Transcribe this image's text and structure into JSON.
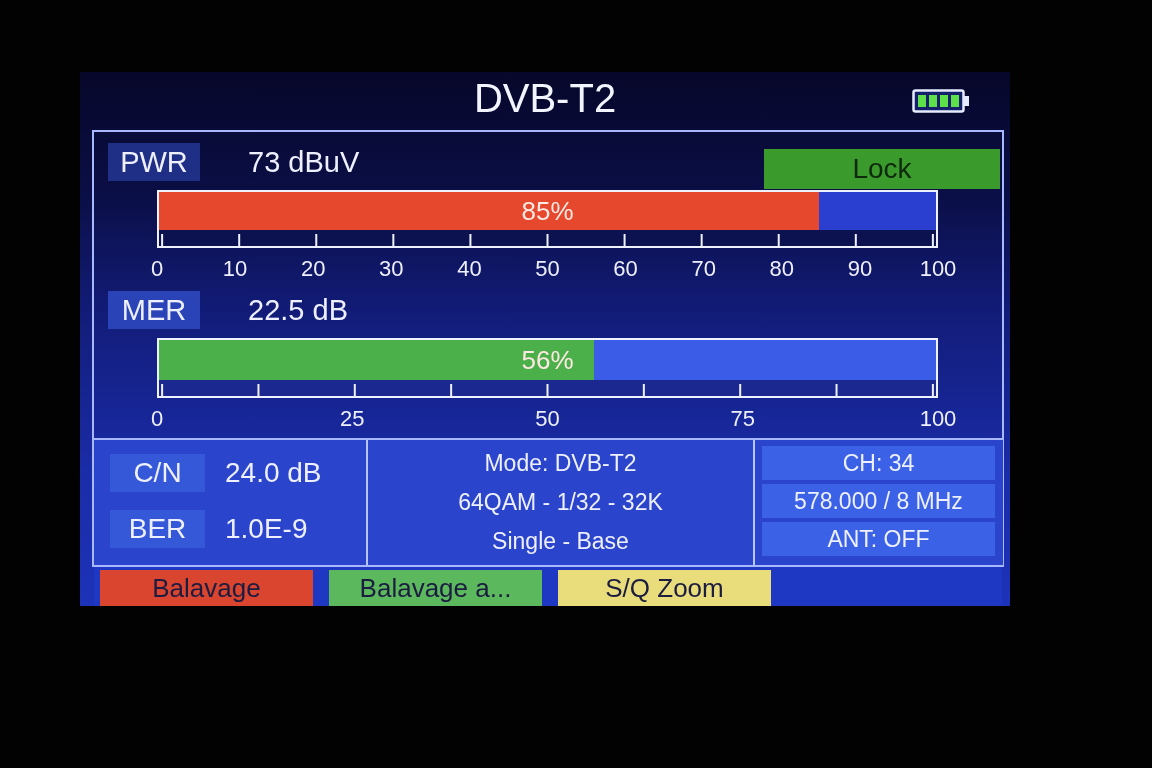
{
  "screen": {
    "title": "DVB-T2"
  },
  "meters": [
    {
      "label": "PWR",
      "reading": "73 dBuV",
      "level": 0.85,
      "percent": "85%",
      "color": "#e5482c",
      "half_ticks": false,
      "scale": [
        "0",
        "10",
        "20",
        "30",
        "40",
        "50",
        "60",
        "70",
        "80",
        "90",
        "100"
      ],
      "badge": {
        "label": "Lock",
        "locked": true
      }
    },
    {
      "label": "MER",
      "reading": "22.5 dB",
      "level": 0.56,
      "percent": "56%",
      "color": "#4cb04a",
      "half_ticks": true,
      "scale": [
        "0",
        "25",
        "50",
        "75",
        "100"
      ]
    }
  ],
  "measurements": [
    {
      "label": "C/N",
      "value": "24.0 dB"
    },
    {
      "label": "BER",
      "value": "1.0E-9"
    }
  ],
  "signal_info": [
    "Mode: DVB-T2",
    "64QAM - 1/32 - 32K",
    "Single - Base"
  ],
  "channel_info": [
    "CH: 34",
    "578.000 / 8 MHz",
    "ANT: OFF"
  ],
  "softkeys": [
    {
      "label": "Balavage",
      "color": "#d9452e"
    },
    {
      "label": "Balavage a...",
      "color": "#5cb85c"
    },
    {
      "label": "S/Q Zoom",
      "color": "#e9dc7a"
    }
  ]
}
